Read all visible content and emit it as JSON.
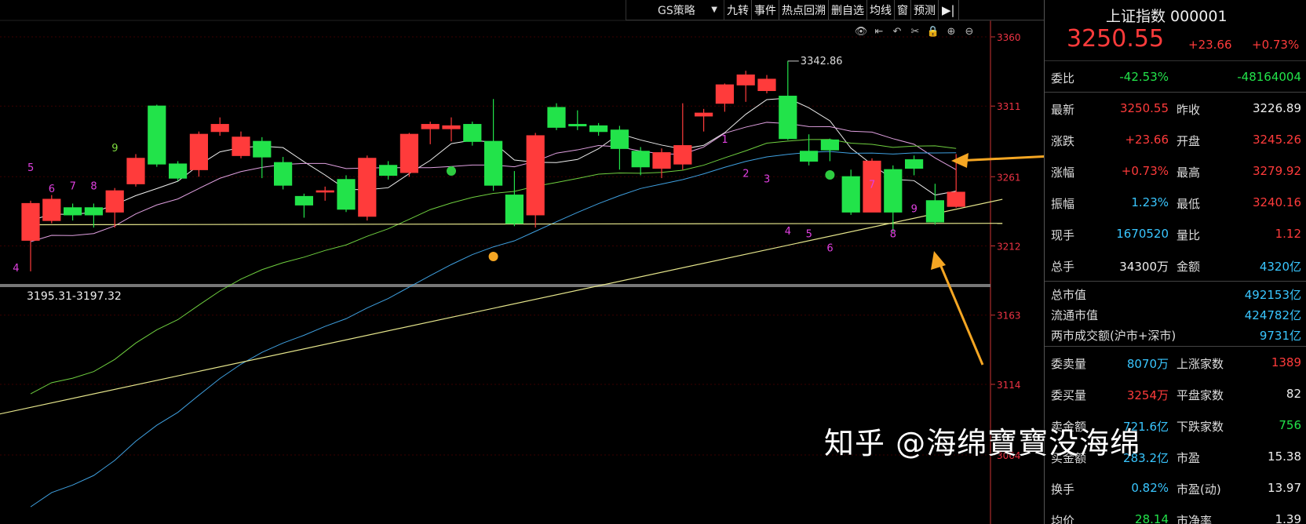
{
  "toolbar": {
    "strategy_label": "GS策略",
    "dropdown_arrow": "▼",
    "buttons": [
      "九转",
      "事件",
      "热点回溯",
      "删自选",
      "均线",
      "窗",
      "预测"
    ],
    "end_icon": "▶|"
  },
  "icon_row": [
    "eye-icon",
    "arrow-left-icon",
    "undo-icon",
    "cut-icon",
    "lock-icon",
    "zoom-in-icon",
    "zoom-out-icon"
  ],
  "chart": {
    "high_label": "3342.86",
    "range_label": "3195.31-3197.32",
    "y_ticks": [
      "3360",
      "3311",
      "3261",
      "3212",
      "3163",
      "3114",
      "3064"
    ],
    "nine_turn_labels": [
      "4",
      "5",
      "6",
      "7",
      "8",
      "9",
      "1",
      "2",
      "3",
      "4",
      "5",
      "6",
      "7",
      "8",
      "9"
    ]
  },
  "chart_data": {
    "type": "candlestick",
    "yrange": [
      3064,
      3360
    ],
    "y_ticks": [
      3360,
      3311,
      3261,
      3212,
      3163,
      3114,
      3064
    ],
    "high_marker": 3342.86,
    "range_marker": "3195.31-3197.32",
    "candles": [
      {
        "o": 3216,
        "c": 3242,
        "h": 3244,
        "l": 3194
      },
      {
        "o": 3230,
        "c": 3245,
        "h": 3248,
        "l": 3228
      },
      {
        "o": 3239,
        "c": 3234,
        "h": 3242,
        "l": 3230
      },
      {
        "o": 3239,
        "c": 3234,
        "h": 3242,
        "l": 3225
      },
      {
        "o": 3236,
        "c": 3251,
        "h": 3253,
        "l": 3225
      },
      {
        "o": 3256,
        "c": 3274,
        "h": 3277,
        "l": 3254
      },
      {
        "o": 3311,
        "c": 3270,
        "h": 3312,
        "l": 3268
      },
      {
        "o": 3270,
        "c": 3260,
        "h": 3272,
        "l": 3258
      },
      {
        "o": 3266,
        "c": 3291,
        "h": 3293,
        "l": 3261
      },
      {
        "o": 3293,
        "c": 3298,
        "h": 3303,
        "l": 3290
      },
      {
        "o": 3276,
        "c": 3289,
        "h": 3293,
        "l": 3274
      },
      {
        "o": 3286,
        "c": 3275,
        "h": 3289,
        "l": 3260
      },
      {
        "o": 3271,
        "c": 3255,
        "h": 3275,
        "l": 3252
      },
      {
        "o": 3247,
        "c": 3241,
        "h": 3249,
        "l": 3232
      },
      {
        "o": 3251,
        "c": 3251,
        "h": 3254,
        "l": 3244
      },
      {
        "o": 3259,
        "c": 3238,
        "h": 3262,
        "l": 3236
      },
      {
        "o": 3233,
        "c": 3274,
        "h": 3276,
        "l": 3230
      },
      {
        "o": 3269,
        "c": 3262,
        "h": 3272,
        "l": 3259
      },
      {
        "o": 3264,
        "c": 3291,
        "h": 3292,
        "l": 3261
      },
      {
        "o": 3295,
        "c": 3298,
        "h": 3300,
        "l": 3284
      },
      {
        "o": 3295,
        "c": 3297,
        "h": 3303,
        "l": 3286
      },
      {
        "o": 3298,
        "c": 3286,
        "h": 3300,
        "l": 3283
      },
      {
        "o": 3286,
        "c": 3255,
        "h": 3316,
        "l": 3251
      },
      {
        "o": 3248,
        "c": 3228,
        "h": 3265,
        "l": 3226
      },
      {
        "o": 3234,
        "c": 3290,
        "h": 3292,
        "l": 3225
      },
      {
        "o": 3310,
        "c": 3296,
        "h": 3313,
        "l": 3294
      },
      {
        "o": 3298,
        "c": 3297,
        "h": 3308,
        "l": 3294
      },
      {
        "o": 3297,
        "c": 3293,
        "h": 3299,
        "l": 3290
      },
      {
        "o": 3294,
        "c": 3281,
        "h": 3297,
        "l": 3266
      },
      {
        "o": 3279,
        "c": 3268,
        "h": 3282,
        "l": 3262
      },
      {
        "o": 3267,
        "c": 3278,
        "h": 3281,
        "l": 3260
      },
      {
        "o": 3270,
        "c": 3283,
        "h": 3313,
        "l": 3266
      },
      {
        "o": 3304,
        "c": 3306,
        "h": 3309,
        "l": 3293
      },
      {
        "o": 3313,
        "c": 3326,
        "h": 3327,
        "l": 3307
      },
      {
        "o": 3326,
        "c": 3333,
        "h": 3336,
        "l": 3314
      },
      {
        "o": 3322,
        "c": 3330,
        "h": 3333,
        "l": 3320
      },
      {
        "o": 3318,
        "c": 3288,
        "h": 3343,
        "l": 3287
      },
      {
        "o": 3279,
        "c": 3272,
        "h": 3291,
        "l": 3269
      },
      {
        "o": 3287,
        "c": 3280,
        "h": 3288,
        "l": 3272
      },
      {
        "o": 3261,
        "c": 3236,
        "h": 3266,
        "l": 3234
      },
      {
        "o": 3236,
        "c": 3272,
        "h": 3274,
        "l": 3236
      },
      {
        "o": 3266,
        "c": 3236,
        "h": 3269,
        "l": 3222
      },
      {
        "o": 3273,
        "c": 3267,
        "h": 3276,
        "l": 3262
      },
      {
        "o": 3244,
        "c": 3229,
        "h": 3256,
        "l": 3227
      },
      {
        "o": 3240,
        "c": 3250,
        "h": 3277,
        "l": 3239
      }
    ],
    "trendlines": [
      {
        "name": "horizontal support",
        "from": [
          0,
          3227
        ],
        "to": [
          44,
          3228
        ]
      },
      {
        "name": "rising support",
        "from": [
          -2,
          3090
        ],
        "to": [
          44,
          3245
        ]
      }
    ]
  },
  "panel": {
    "title": "上证指数 000001",
    "price": "3250.55",
    "change": "+23.66",
    "change_pct": "+0.73%",
    "rows": [
      {
        "l1": "委比",
        "v1": "-42.53%",
        "c1": "green",
        "l2": "",
        "v2": "-48164004",
        "c2": "green"
      },
      {
        "l1": "最新",
        "v1": "3250.55",
        "c1": "red",
        "l2": "昨收",
        "v2": "3226.89",
        "c2": "white"
      },
      {
        "l1": "涨跌",
        "v1": "+23.66",
        "c1": "red",
        "l2": "开盘",
        "v2": "3245.26",
        "c2": "red"
      },
      {
        "l1": "涨幅",
        "v1": "+0.73%",
        "c1": "red",
        "l2": "最高",
        "v2": "3279.92",
        "c2": "red"
      },
      {
        "l1": "振幅",
        "v1": "1.23%",
        "c1": "cyan",
        "l2": "最低",
        "v2": "3240.16",
        "c2": "red"
      },
      {
        "l1": "现手",
        "v1": "1670520",
        "c1": "cyan",
        "l2": "量比",
        "v2": "1.12",
        "c2": "red"
      },
      {
        "l1": "总手",
        "v1": "34300万",
        "c1": "white",
        "l2": "金额",
        "v2": "4320亿",
        "c2": "cyan"
      }
    ],
    "mkt_rows": [
      {
        "l": "总市值",
        "v": "492153亿"
      },
      {
        "l": "流通市值",
        "v": "424782亿"
      },
      {
        "l": "两市成交额(沪市+深市)",
        "v": "9731亿"
      }
    ],
    "rows2": [
      {
        "l1": "委卖量",
        "v1": "8070万",
        "c1": "cyan",
        "l2": "上涨家数",
        "v2": "1389",
        "c2": "red"
      },
      {
        "l1": "委买量",
        "v1": "3254万",
        "c1": "red",
        "l2": "平盘家数",
        "v2": "82",
        "c2": "white"
      },
      {
        "l1": "卖金额",
        "v1": "721.6亿",
        "c1": "cyan",
        "l2": "下跌家数",
        "v2": "756",
        "c2": "green"
      },
      {
        "l1": "买金额",
        "v1": "283.2亿",
        "c1": "cyan",
        "l2": "市盈",
        "v2": "15.38",
        "c2": "white"
      },
      {
        "l1": "换手",
        "v1": "0.82%",
        "c1": "cyan",
        "l2": "市盈(动)",
        "v2": "13.97",
        "c2": "white"
      },
      {
        "l1": "均价",
        "v1": "28.14",
        "c1": "green",
        "l2": "市净率",
        "v2": "1.39",
        "c2": "white"
      }
    ]
  },
  "watermark": "知乎 @海绵寶寶没海绵",
  "colors": {
    "up": "#ff3b3b",
    "down": "#22e34a",
    "arrow": "#f5a623"
  }
}
